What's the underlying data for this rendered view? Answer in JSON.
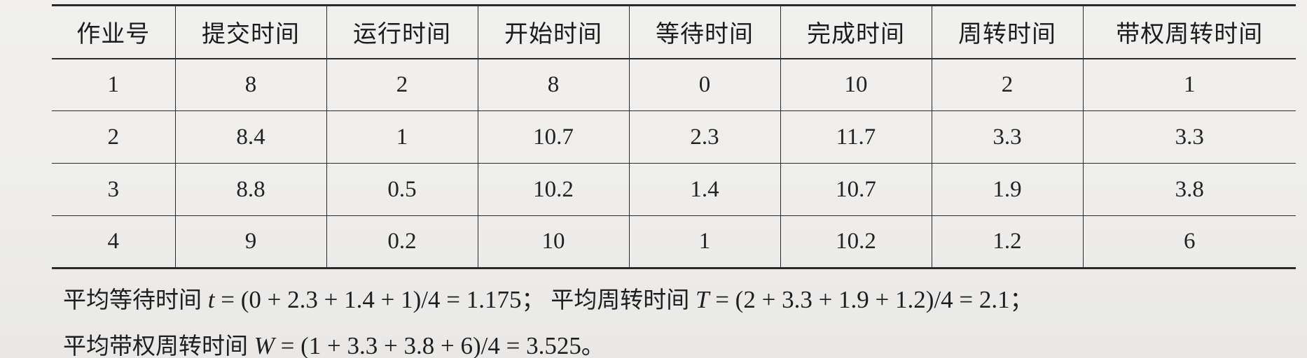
{
  "table": {
    "headers": [
      "作业号",
      "提交时间",
      "运行时间",
      "开始时间",
      "等待时间",
      "完成时间",
      "周转时间",
      "带权周转时间"
    ],
    "rows": [
      [
        "1",
        "8",
        "2",
        "8",
        "0",
        "10",
        "2",
        "1"
      ],
      [
        "2",
        "8.4",
        "1",
        "10.7",
        "2.3",
        "11.7",
        "3.3",
        "3.3"
      ],
      [
        "3",
        "8.8",
        "0.5",
        "10.2",
        "1.4",
        "10.7",
        "1.9",
        "3.8"
      ],
      [
        "4",
        "9",
        "0.2",
        "10",
        "1",
        "10.2",
        "1.2",
        "6"
      ]
    ]
  },
  "summary": {
    "avg_wait_label": "平均等待时间",
    "avg_wait_var": "t",
    "avg_wait_expr": " = (0 + 2.3 + 1.4 + 1)/4 = 1.175",
    "sep1": "；",
    "avg_turnaround_label": "平均周转时间",
    "avg_turnaround_var": "T",
    "avg_turnaround_expr": " = (2 + 3.3 + 1.9 + 1.2)/4 = 2.1",
    "sep2": "；",
    "avg_weighted_label": "平均带权周转时间",
    "avg_weighted_var": "W",
    "avg_weighted_expr": " = (1 + 3.3 + 3.8 + 6)/4 = 3.525",
    "end": "。"
  }
}
